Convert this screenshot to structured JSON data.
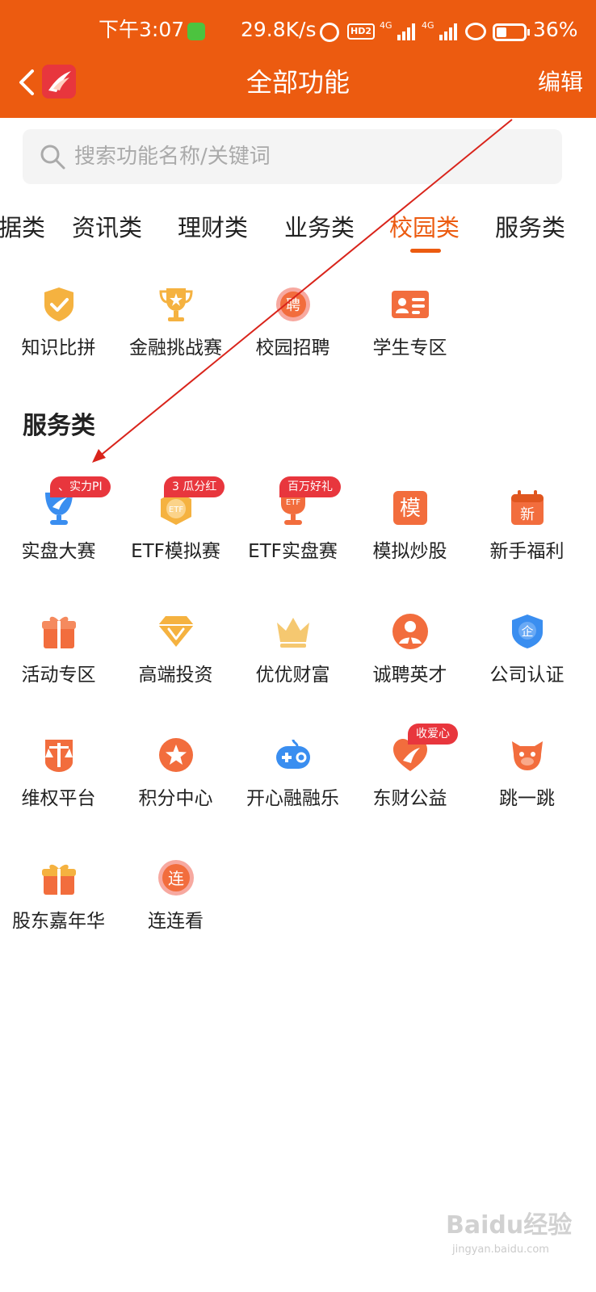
{
  "status_bar": {
    "time": "下午3:07",
    "net_speed": "29.8K/s",
    "hd_badge": "HD2",
    "net1": "4G",
    "net2": "4G",
    "battery_text": "36%",
    "battery_level": 0.36
  },
  "nav": {
    "title": "全部功能",
    "edit_label": "编辑"
  },
  "search": {
    "placeholder": "搜索功能名称/关键词"
  },
  "tabs": [
    {
      "label": "据类"
    },
    {
      "label": "资讯类"
    },
    {
      "label": "理财类"
    },
    {
      "label": "业务类"
    },
    {
      "label": "校园类",
      "active": true
    },
    {
      "label": "服务类"
    }
  ],
  "campus": {
    "items": [
      {
        "label": "知识比拼",
        "icon": "shield-check-icon"
      },
      {
        "label": "金融挑战赛",
        "icon": "trophy-icon"
      },
      {
        "label": "校园招聘",
        "icon": "recruit-icon"
      },
      {
        "label": "学生专区",
        "icon": "student-card-icon"
      }
    ]
  },
  "service": {
    "title": "服务类",
    "items": [
      {
        "label": "实盘大赛",
        "icon": "cup-icon",
        "badge": "、实力PI"
      },
      {
        "label": "ETF模拟赛",
        "icon": "etf-medal-icon",
        "badge": "3 瓜分红"
      },
      {
        "label": "ETF实盘赛",
        "icon": "etf-trophy-icon",
        "badge": "百万好礼"
      },
      {
        "label": "模拟炒股",
        "icon": "simulate-icon",
        "glyph": "模"
      },
      {
        "label": "新手福利",
        "icon": "calendar-new-icon",
        "glyph": "新"
      },
      {
        "label": "活动专区",
        "icon": "gift-icon"
      },
      {
        "label": "高端投资",
        "icon": "diamond-icon"
      },
      {
        "label": "优优财富",
        "icon": "crown-icon"
      },
      {
        "label": "诚聘英才",
        "icon": "recruiter-icon"
      },
      {
        "label": "公司认证",
        "icon": "company-shield-icon",
        "glyph": "企"
      },
      {
        "label": "维权平台",
        "icon": "scales-icon"
      },
      {
        "label": "积分中心",
        "icon": "star-icon"
      },
      {
        "label": "开心融融乐",
        "icon": "gamepad-icon"
      },
      {
        "label": "东财公益",
        "icon": "heart-icon",
        "badge": "收爱心"
      },
      {
        "label": "跳一跳",
        "icon": "jump-icon"
      },
      {
        "label": "股东嘉年华",
        "icon": "carnival-gift-icon"
      },
      {
        "label": "连连看",
        "icon": "link-icon",
        "glyph": "连"
      }
    ]
  },
  "colors": {
    "brand": "#ec5b10",
    "badge": "#e8363d",
    "icon_orange": "#f26d3d",
    "icon_gold": "#f5b240",
    "icon_blue": "#3a8ef0"
  },
  "watermark": {
    "text": "Baidu经验",
    "url": "jingyan.baidu.com"
  }
}
